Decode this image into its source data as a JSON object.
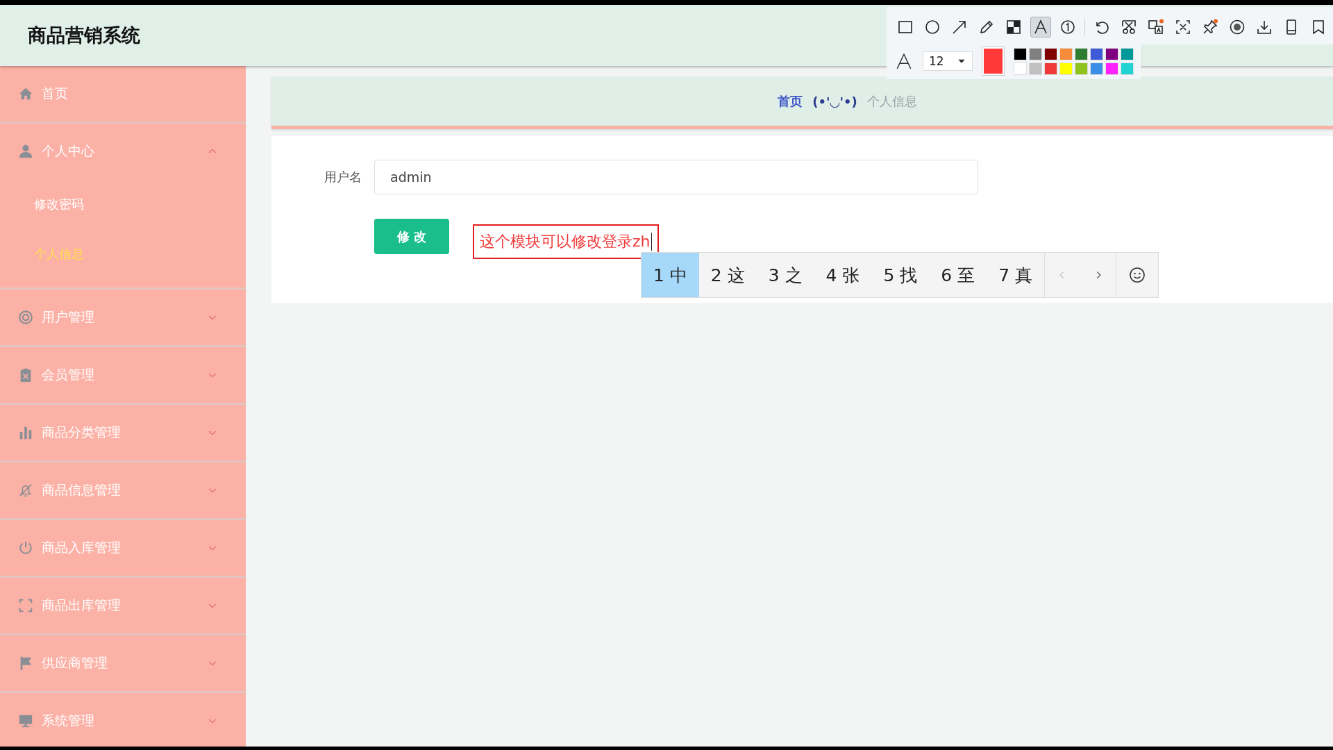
{
  "header": {
    "title": "商品营销系统"
  },
  "sidebar": {
    "items": [
      {
        "label": "首页",
        "kind": "link"
      },
      {
        "label": "个人中心",
        "kind": "menu",
        "expanded": true,
        "children": [
          {
            "label": "修改密码",
            "selected": false
          },
          {
            "label": "个人信息",
            "selected": true
          }
        ]
      },
      {
        "label": "用户管理",
        "kind": "menu",
        "expanded": false
      },
      {
        "label": "会员管理",
        "kind": "menu",
        "expanded": false
      },
      {
        "label": "商品分类管理",
        "kind": "menu",
        "expanded": false
      },
      {
        "label": "商品信息管理",
        "kind": "menu",
        "expanded": false
      },
      {
        "label": "商品入库管理",
        "kind": "menu",
        "expanded": false
      },
      {
        "label": "商品出库管理",
        "kind": "menu",
        "expanded": false
      },
      {
        "label": "供应商管理",
        "kind": "menu",
        "expanded": false
      },
      {
        "label": "系统管理",
        "kind": "menu",
        "expanded": false
      }
    ]
  },
  "breadcrumb": [
    {
      "label": "首页",
      "kind": "link"
    },
    {
      "label": "(•'◡'•)",
      "kind": "separator"
    },
    {
      "label": "个人信息",
      "kind": "current"
    }
  ],
  "form": {
    "fields": [
      {
        "label": "用户名",
        "value": "admin"
      }
    ],
    "submit_button": "修 改"
  },
  "annotation": {
    "text": "这个模块可以修改登录zh"
  },
  "ime_candidates": {
    "candidates": [
      {
        "index": "1",
        "text": "中",
        "selected": true
      },
      {
        "index": "2",
        "text": "这",
        "selected": false
      },
      {
        "index": "3",
        "text": "之",
        "selected": false
      },
      {
        "index": "4",
        "text": "张",
        "selected": false
      },
      {
        "index": "5",
        "text": "找",
        "selected": false
      },
      {
        "index": "6",
        "text": "至",
        "selected": false
      },
      {
        "index": "7",
        "text": "真",
        "selected": false
      }
    ]
  },
  "capture_toolbar": {
    "tool_groups": [
      {
        "tools": [
          {
            "kind": "rectangle",
            "selected": false
          },
          {
            "kind": "ellipse",
            "selected": false
          },
          {
            "kind": "arrow",
            "selected": false
          },
          {
            "kind": "pencil",
            "selected": false
          },
          {
            "kind": "mosaic",
            "selected": false
          },
          {
            "kind": "text",
            "selected": true
          },
          {
            "kind": "number",
            "selected": false
          }
        ]
      },
      {
        "tools": [
          {
            "kind": "undo",
            "selected": false
          },
          {
            "kind": "cut",
            "selected": false
          },
          {
            "kind": "translate",
            "selected": false
          },
          {
            "kind": "ocr",
            "selected": false
          },
          {
            "kind": "pin",
            "selected": false
          },
          {
            "kind": "record",
            "selected": false
          },
          {
            "kind": "download",
            "selected": false
          },
          {
            "kind": "device",
            "selected": false
          },
          {
            "kind": "bookmark",
            "selected": false
          }
        ]
      }
    ],
    "font_size": "12",
    "current_color": {
      "color": "#ff3838"
    },
    "palette": [
      {
        "color": "#000000"
      },
      {
        "color": "#808080"
      },
      {
        "color": "#800000"
      },
      {
        "color": "#f68b3a"
      },
      {
        "color": "#2e7d32"
      },
      {
        "color": "#3d5bd8"
      },
      {
        "color": "#800080"
      },
      {
        "color": "#00999a"
      },
      {
        "color": "#ffffff"
      },
      {
        "color": "#c0c0c0"
      },
      {
        "color": "#f03a3a"
      },
      {
        "color": "#ffff00"
      },
      {
        "color": "#8fc31f"
      },
      {
        "color": "#3a8ee6"
      },
      {
        "color": "#ff22ff"
      },
      {
        "color": "#22d3d3"
      }
    ]
  }
}
